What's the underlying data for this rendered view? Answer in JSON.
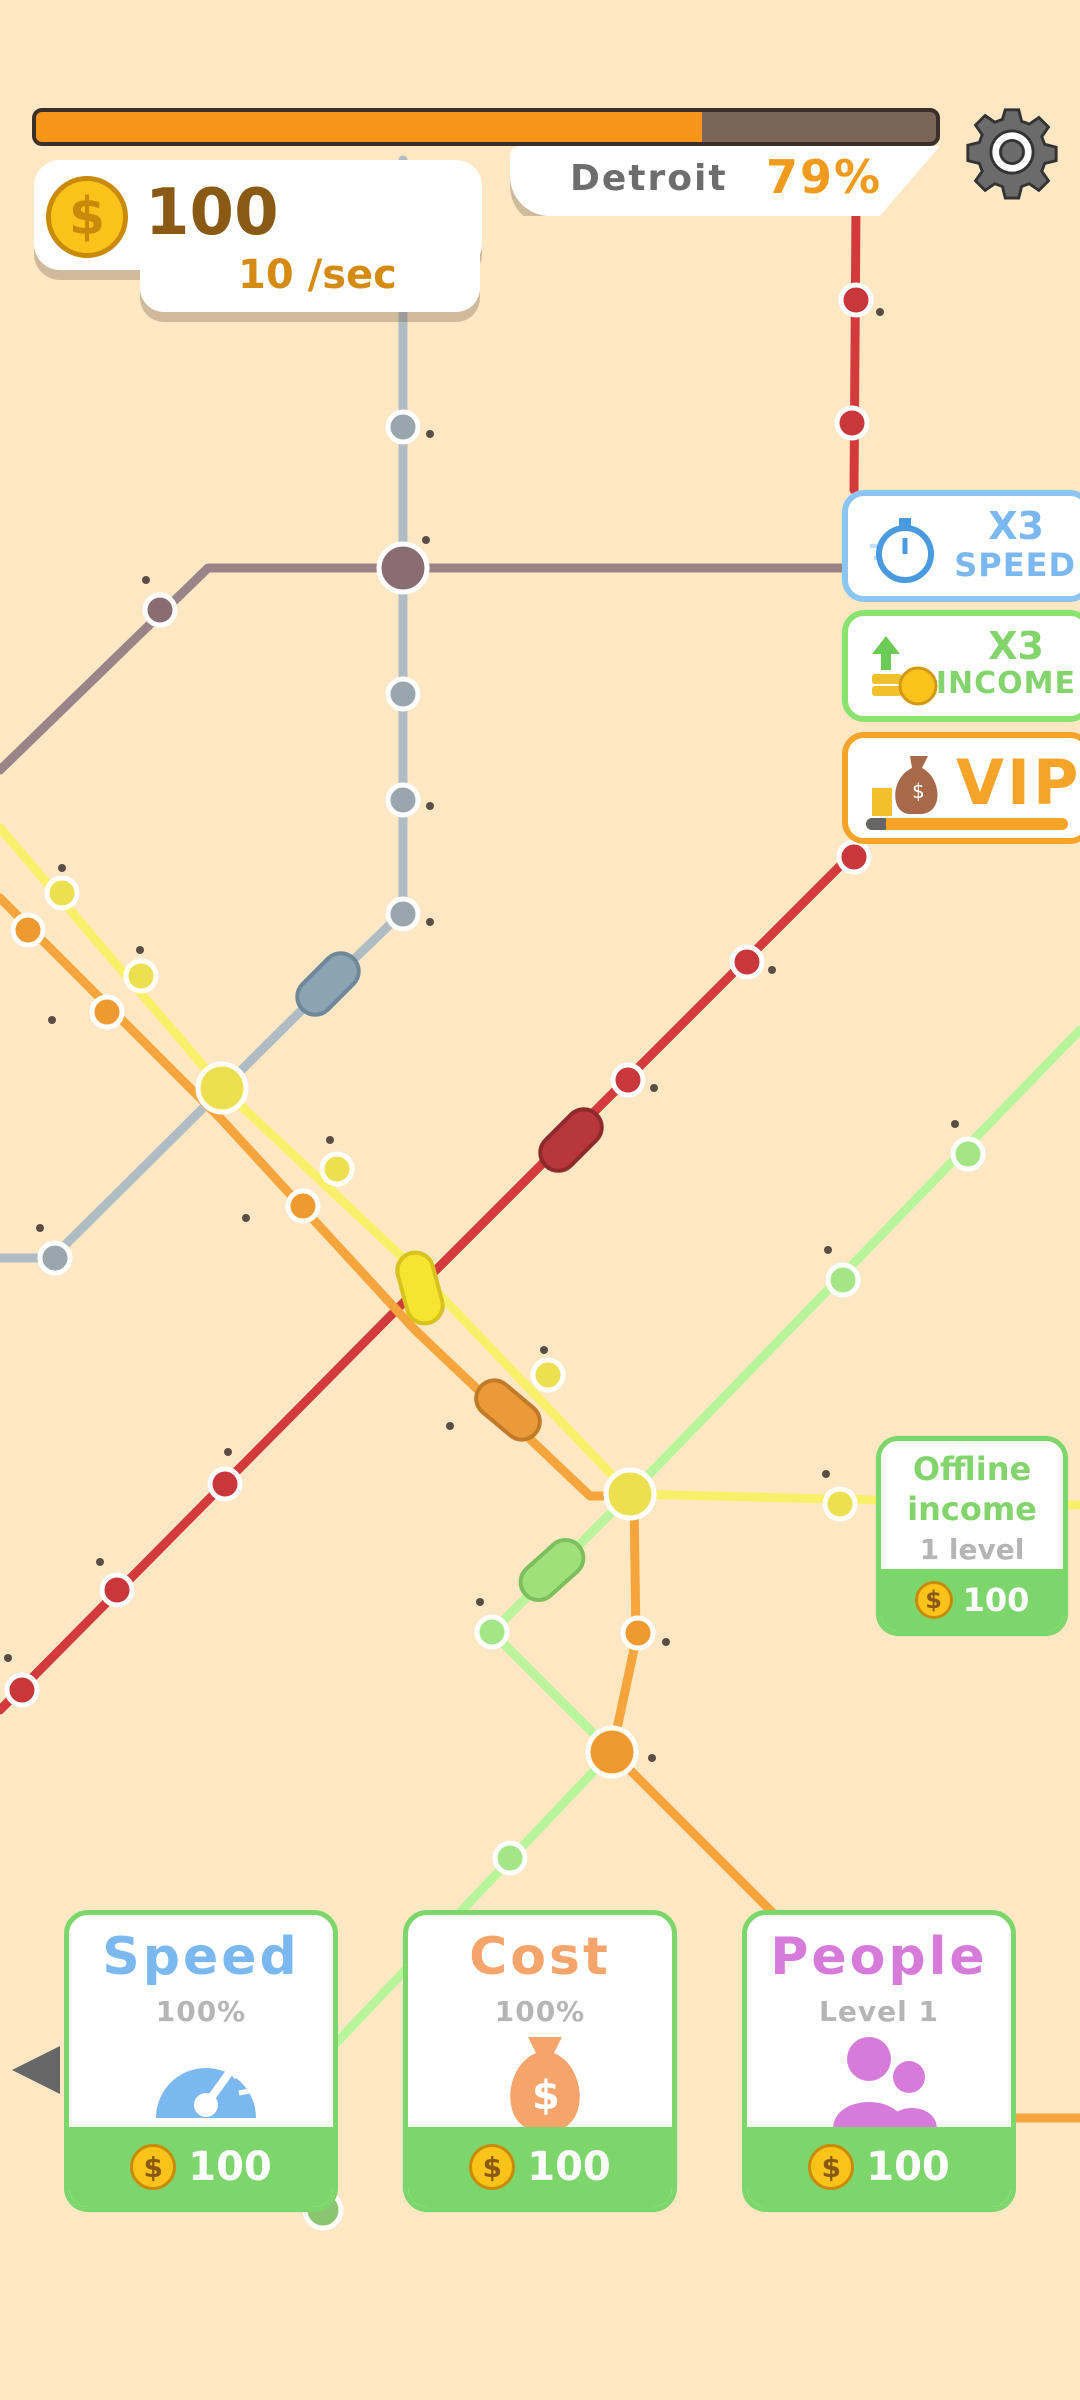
{
  "hud": {
    "money": "100",
    "money_rate": "10 /sec",
    "city_name": "Detroit",
    "city_progress": "79%",
    "city_progress_fraction": 0.74,
    "coin_symbol": "$"
  },
  "boosters": {
    "speed": {
      "top": "X3",
      "bottom": "SPEED"
    },
    "income": {
      "top": "X3",
      "bottom": "INCOME"
    },
    "vip": {
      "label": "VIP",
      "progress_fraction": 0.1
    }
  },
  "offline_income": {
    "title": "Offline\nincome",
    "level": "1 level",
    "cost": "100"
  },
  "upgrades": [
    {
      "title": "Speed",
      "subtitle": "100%",
      "cost": "100",
      "color": "#7ab8ef",
      "icon": "speedometer-icon"
    },
    {
      "title": "Cost",
      "subtitle": "100%",
      "cost": "100",
      "color": "#f5a56b",
      "icon": "money-bag-icon"
    },
    {
      "title": "People",
      "subtitle": "Level 1",
      "cost": "100",
      "color": "#d77bdb",
      "icon": "people-icon"
    }
  ],
  "colors": {
    "background": "#fde8c3",
    "progress_fill": "#f7951a",
    "line_red": "#d23a3c",
    "line_grey": "#b0bcc4",
    "line_purple": "#9b8488",
    "line_yellow": "#f9f06a",
    "line_orange": "#f5a53c",
    "line_green": "#b8f59a",
    "card_green": "#7cd66c"
  }
}
